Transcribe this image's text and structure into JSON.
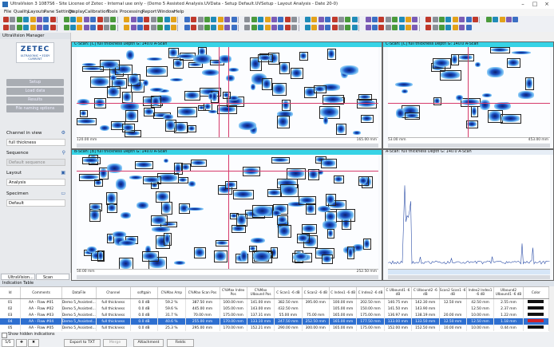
{
  "window": {
    "title": "UltraVision 3 1087S6 - Site License of Zetec - Internal use only - (Demo 5 Assisted Analysis.UVData - Setup Default.UVSetup - Layout Analysis - Date 20-0)",
    "minimize": "–",
    "maximize": "□",
    "close": "×"
  },
  "menu": [
    "File",
    "Quality",
    "Layouts",
    "Pane Settings",
    "Display",
    "Calibration",
    "Tools",
    "Processing",
    "Report",
    "Window",
    "Help"
  ],
  "left_panel": {
    "header": "UltraVision Manager",
    "logo": "ZETEC",
    "logo_sub": "ULTRASONIC • EDDY CURRENT",
    "buttons": [
      "Setup",
      "Load data",
      "Results",
      "File naming options"
    ],
    "channel_in_view_label": "Channel in view",
    "channel_value": "full thickness",
    "sequence_label": "Sequence",
    "sequence_value": "Default sequence",
    "layout_label": "Layout",
    "layout_value": "Analysis",
    "specimen_label": "Specimen",
    "specimen_value": "Default"
  },
  "views": {
    "top_left": {
      "header": "C-Scan: [C] full thickness Depth   G: 140.0 A-Scan",
      "ruler_left": "120.00 mm",
      "ruler_right": "165.00 mm",
      "ticks": [
        "50",
        "100",
        "150",
        "200",
        "250",
        "300",
        "350",
        "400",
        "450"
      ],
      "marker": "250.00"
    },
    "top_right": {
      "header": "C-Scan: [C] full thickness Depth   G: 140.0 A-Scan",
      "ruler_left": "53.00 mm",
      "ruler_right": "453.00 mm",
      "ticks": [
        "0",
        "50",
        "100",
        "150"
      ]
    },
    "bottom_left": {
      "header": "B-Scan: [B] full thickness Depth   G: 140.0 A-Scan",
      "ruler_left": "50.00 mm",
      "ruler_right": "252.50 mm",
      "ticks": [
        "50",
        "100",
        "150",
        "200",
        "250",
        "300",
        "350",
        "400",
        "450"
      ],
      "marker": "250.00"
    },
    "bottom_right": {
      "header": "A-Scan: full thickness Depth   G: 140.0 A-Scan",
      "ticks": [
        "0",
        "50",
        "100",
        "150"
      ]
    }
  },
  "bottom_tabs": [
    "UltraVision...",
    "Scan informa..."
  ],
  "indication_table": {
    "title": "Indication Table",
    "columns": [
      "Id",
      "Comments",
      "DataFile",
      "Channel",
      "softgain",
      "C%Max Amp",
      "C%Max Scan Pos",
      "C%Max Index Pos",
      "C%Max UIbound Pos",
      "C Scan1 -6 dB",
      "C Scan2 -6 dB",
      "C Index1 -6 dB",
      "C Index2 -6 dB",
      "C UIbound1 -6 dB",
      "C UIbound2 -6 dB",
      "Scan2 Scan1 -6 dB",
      "Index2 Index1 -6 dB",
      "UIbound2 UIbound1 -6 dB",
      "Color"
    ],
    "rows": [
      {
        "cells": [
          "01",
          "AA - Flaw #01",
          "Demo 5_Assisted...",
          "full thickness",
          "0.0 dB",
          "59.2 %",
          "387.50 mm",
          "100.00 mm",
          "141.00 mm",
          "382.50 mm",
          "395.00 mm",
          "100.00 mm",
          "202.50 mm",
          "140.75 mm",
          "142.30 mm",
          "12.50 mm",
          "42.50 mm",
          "2.55 mm"
        ],
        "color": "#111111",
        "selected": false
      },
      {
        "cells": [
          "02",
          "AA - Flaw #02",
          "Demo 5_Assisted...",
          "full thickness",
          "0.0 dB",
          "59.6 %",
          "445.00 mm",
          "105.00 mm",
          "143.00 mm",
          "432.50 mm",
          "",
          "105.00 mm",
          "150.00 mm",
          "141.50 mm",
          "143.90 mm",
          "",
          "12.50 mm",
          "2.37 mm"
        ],
        "color": "#111111",
        "selected": false
      },
      {
        "cells": [
          "03",
          "AA - Flaw #03",
          "Demo 5_Assisted...",
          "full thickness",
          "0.0 dB",
          "31.7 %",
          "70.00 mm",
          "175.00 mm",
          "137.31 mm",
          "55.00 mm",
          "75.00 mm",
          "165.00 mm",
          "175.00 mm",
          "136.97 mm",
          "138.19 mm",
          "20.00 mm",
          "10.00 mm",
          "1.22 mm"
        ],
        "color": "#111111",
        "selected": false
      },
      {
        "cells": [
          "04",
          "AA - Flaw #04",
          "Demo 5_Assisted...",
          "full thickness",
          "0.0 dB",
          "40.6 %",
          "255.00 mm",
          "170.00 mm",
          "133.10 mm",
          "247.50 mm",
          "252.50 mm",
          "165.00 mm",
          "177.50 mm",
          "133.00 mm",
          "133.50 mm",
          "12.50 mm",
          "12.50 mm",
          "1.18 mm"
        ],
        "color": "#d0202a",
        "selected": true
      },
      {
        "cells": [
          "05",
          "AA - Flaw #05",
          "Demo 5_Assisted...",
          "full thickness",
          "0.0 dB",
          "25.3 %",
          "295.00 mm",
          "170.00 mm",
          "152.21 mm",
          "290.00 mm",
          "300.00 mm",
          "165.00 mm",
          "175.00 mm",
          "152.00 mm",
          "152.50 mm",
          "10.00 mm",
          "10.00 mm",
          "0.44 mm"
        ],
        "color": "#111111",
        "selected": false
      }
    ],
    "show_hidden_label": "Show hidden indications",
    "count": "5/5",
    "export_label": "Export to TXT",
    "merge_label": "Merge",
    "attachment_label": "Attachment",
    "fields_label": "Fields"
  }
}
